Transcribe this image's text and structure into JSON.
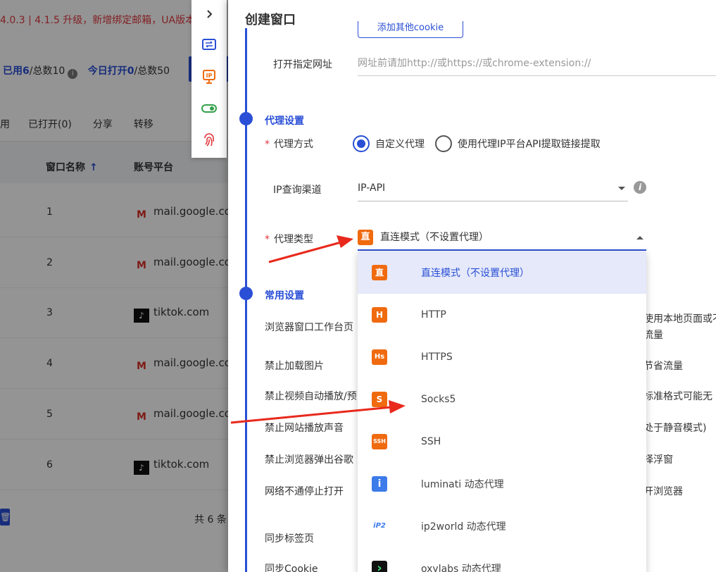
{
  "background": {
    "notice": "4.0.3 | 4.1.5 升级，新增绑定邮箱，UA版本",
    "stats": {
      "used_label": "已用6",
      "total_label": "/总数10",
      "today_label": "今日打开0",
      "today_total": "/总数50"
    },
    "tabs": [
      "用",
      "已打开(0)",
      "分享",
      "转移"
    ],
    "columns": {
      "name": "窗口名称",
      "platform": "账号平台"
    },
    "rows": [
      {
        "idx": "1",
        "platform": "mail.google.com",
        "type": "gmail"
      },
      {
        "idx": "2",
        "platform": "mail.google.com",
        "type": "gmail"
      },
      {
        "idx": "3",
        "platform": "tiktok.com",
        "type": "tiktok"
      },
      {
        "idx": "4",
        "platform": "mail.google.com",
        "type": "gmail"
      },
      {
        "idx": "5",
        "platform": "mail.google.com",
        "type": "gmail"
      },
      {
        "idx": "6",
        "platform": "tiktok.com",
        "type": "tiktok"
      }
    ],
    "total": "共 6 条"
  },
  "drawer": {
    "title": "创建窗口",
    "add_cookie": "添加其他cookie",
    "open_url_label": "打开指定网址",
    "open_url_placeholder": "网址前请加http://或https://或chrome-extension://",
    "proxy_section": "代理设置",
    "proxy_method_label": "代理方式",
    "proxy_method_options": [
      "自定义代理",
      "使用代理IP平台API提取链接提取"
    ],
    "ip_channel_label": "IP查询渠道",
    "ip_channel_value": "IP-API",
    "proxy_type_label": "代理类型",
    "proxy_type_value": "直连模式（不设置代理）",
    "common_section": "常用设置",
    "common_items": [
      "浏览器窗口工作台页",
      "禁止加载图片",
      "禁止视频自动播放/预",
      "禁止网站播放声音",
      "禁止浏览器弹出谷歌",
      "网络不通停止打开",
      "同步标签页",
      "同步Cookie"
    ],
    "right_fragments": [
      "使用本地页面或不",
      "流量",
      "节省流量",
      "标准格式可能无",
      "处于静音模式)",
      "择浮窗",
      "开浏览器"
    ]
  },
  "dropdown": {
    "items": [
      {
        "icon": "直",
        "label": "直连模式（不设置代理）",
        "color": "#f06a0f"
      },
      {
        "icon": "H",
        "label": "HTTP",
        "color": "#f06a0f"
      },
      {
        "icon": "Hs",
        "label": "HTTPS",
        "color": "#f06a0f"
      },
      {
        "icon": "S",
        "label": "Socks5",
        "color": "#f06a0f"
      },
      {
        "icon": "SSH",
        "label": "SSH",
        "color": "#f06a0f"
      },
      {
        "icon": "i",
        "label": "luminati 动态代理",
        "color": "#3d7bea"
      },
      {
        "icon": "iP2",
        "label": "ip2world 动态代理",
        "color": "#3d7bea"
      },
      {
        "icon": "›",
        "label": "oxylabs 动态代理",
        "color": "#111111"
      }
    ]
  },
  "colors": {
    "primary": "#2a4fd6",
    "danger": "#e0383e",
    "proxy_icon": "#f06a0f",
    "arrow": "#e8291c"
  }
}
